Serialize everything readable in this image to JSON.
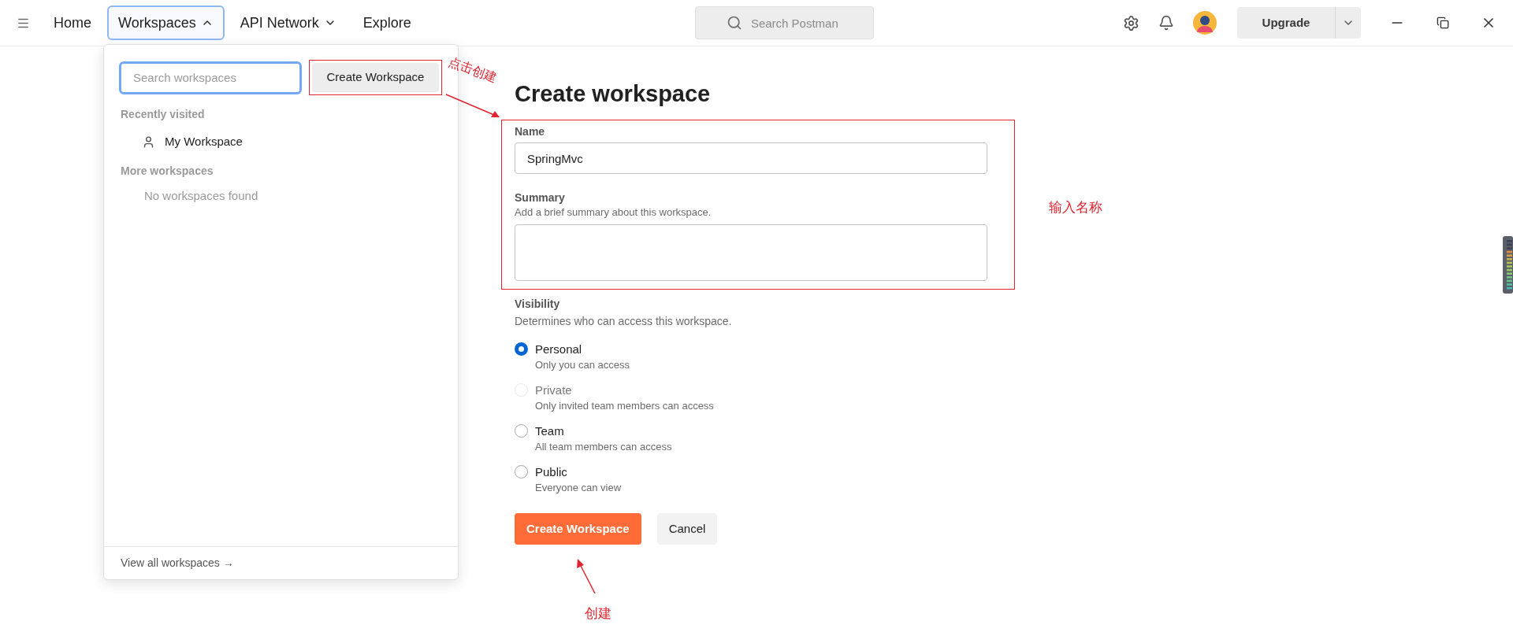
{
  "top_bar": {
    "nav": [
      {
        "label": "Home",
        "kind": "link",
        "selected": false
      },
      {
        "label": "Workspaces",
        "kind": "menu",
        "selected": true
      },
      {
        "label": "API Network",
        "kind": "menu",
        "selected": false
      },
      {
        "label": "Explore",
        "kind": "link",
        "selected": false
      }
    ],
    "search": {
      "placeholder": "Search Postman"
    },
    "upgrade_button": "Upgrade"
  },
  "workspace_menu": {
    "search": {
      "placeholder": "Search workspaces"
    },
    "create_button": "Create Workspace",
    "sections": [
      {
        "title": "Recently visited",
        "items": [
          {
            "label": "My Workspace"
          }
        ]
      },
      {
        "title": "More workspaces",
        "empty_text": "No workspaces found"
      }
    ],
    "footer_link": "View all workspaces →"
  },
  "form": {
    "title": "Create workspace",
    "name": {
      "label": "Name",
      "value": "SpringMvc"
    },
    "summary": {
      "label": "Summary",
      "hint": "Add a brief summary about this workspace."
    },
    "visibility": {
      "label": "Visibility",
      "hint": "Determines who can access this workspace.",
      "options": [
        {
          "label": "Personal",
          "description": "Only you can access",
          "selected": true,
          "disabled": false
        },
        {
          "label": "Private",
          "description": "Only invited team members can access",
          "selected": false,
          "disabled": true
        },
        {
          "label": "Team",
          "description": "All team members can access",
          "selected": false,
          "disabled": false
        },
        {
          "label": "Public",
          "description": "Everyone can view",
          "selected": false,
          "disabled": false
        }
      ]
    },
    "buttons": [
      {
        "label": "Create Workspace",
        "kind": "primary"
      },
      {
        "label": "Cancel",
        "kind": "secondary"
      }
    ]
  },
  "annotations": [
    {
      "text": "点击创建"
    },
    {
      "text": "输入名称"
    },
    {
      "text": "创建"
    }
  ]
}
